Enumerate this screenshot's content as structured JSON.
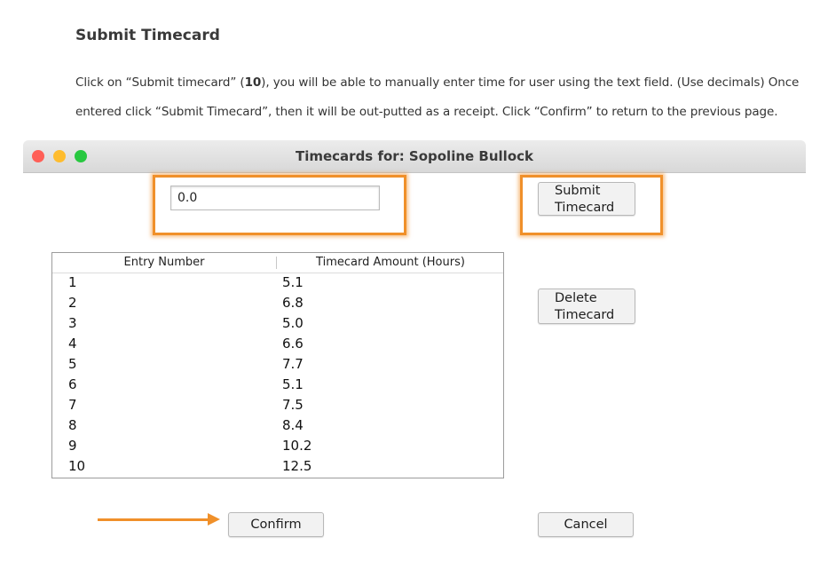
{
  "doc": {
    "heading": "Submit Timecard",
    "para1_pre": "Click on “Submit timecard” (",
    "para1_bold": "10",
    "para1_post": "), you will be able to manually enter time for user using the text field.  (Use decimals) Once",
    "para2": "entered click “Submit Timecard”, then it will be out-putted as a receipt. Click “Confirm” to return to the previous page."
  },
  "window": {
    "title": "Timecards for: Sopoline Bullock"
  },
  "form": {
    "hours_value": "0.0",
    "submit_label_line1": "Submit",
    "submit_label_line2": "Timecard",
    "delete_label_line1": "Delete",
    "delete_label_line2": "Timecard",
    "confirm_label": "Confirm",
    "cancel_label": "Cancel"
  },
  "table": {
    "headers": [
      "Entry Number",
      "Timecard Amount (Hours)"
    ],
    "rows": [
      [
        "1",
        "5.1"
      ],
      [
        "2",
        "6.8"
      ],
      [
        "3",
        "5.0"
      ],
      [
        "4",
        "6.6"
      ],
      [
        "5",
        "7.7"
      ],
      [
        "6",
        "5.1"
      ],
      [
        "7",
        "7.5"
      ],
      [
        "8",
        "8.4"
      ],
      [
        "9",
        "10.2"
      ],
      [
        "10",
        "12.5"
      ]
    ]
  },
  "colors": {
    "highlight": "#f0902a",
    "traffic_red": "#ff5f57",
    "traffic_yellow": "#febc2e",
    "traffic_green": "#28c840"
  },
  "icons": {
    "annotation_arrow": "arrow-right-icon"
  }
}
